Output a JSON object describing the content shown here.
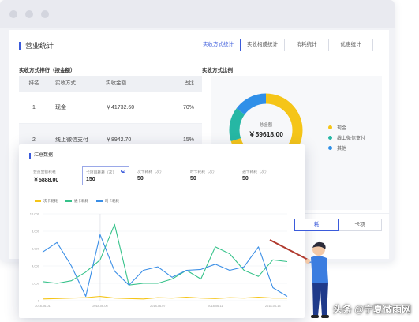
{
  "window": {
    "section_title": "营业统计"
  },
  "tabs": [
    "实收方式统计",
    "实收构成统计",
    "消耗统计",
    "优惠统计"
  ],
  "ranking": {
    "title": "实收方式排行（按金额）",
    "headers": [
      "排名",
      "实收方式",
      "实收金额",
      "占比"
    ],
    "rows": [
      {
        "rank": "1",
        "method": "现金",
        "amount": "￥41732.60",
        "percent": "70%"
      },
      {
        "rank": "2",
        "method": "线上微信支付",
        "amount": "￥8942.70",
        "percent": "15%"
      }
    ]
  },
  "ratio": {
    "title": "实收方式比例",
    "total_label": "总金额",
    "total_value": "￥59618.00",
    "legend": [
      {
        "name": "现金",
        "color": "#f5c518",
        "share": 0.7
      },
      {
        "name": "线上微信支付",
        "color": "#26b7a4",
        "share": 0.15
      },
      {
        "name": "其他",
        "color": "#2f8fe8",
        "share": 0.15
      }
    ]
  },
  "lower_tabs": [
    "耗",
    "卡项"
  ],
  "summary": {
    "title": "汇总数据",
    "metrics": [
      {
        "label": "会员金额耗耗",
        "value": "￥5888.00"
      },
      {
        "label": "卡项目耗耗（次）",
        "value": "150"
      },
      {
        "label": "次卡耗耗（次）",
        "value": "50"
      },
      {
        "label": "时卡耗耗（次）",
        "value": "50"
      },
      {
        "label": "通卡耗耗（次）",
        "value": "50"
      }
    ]
  },
  "chart_data": {
    "type": "line",
    "ylim": [
      0,
      10000
    ],
    "yticks": [
      "10,000",
      "8,000",
      "6,000",
      "4,000",
      "2,000",
      "0"
    ],
    "x_ticks": [
      "2018-06-01",
      "2018-06-06",
      "2018-06-07",
      "2018-06-11",
      "2018-06-13"
    ],
    "x_tick_positions": [
      0,
      4,
      8,
      12,
      16
    ],
    "series": [
      {
        "name": "次卡耗耗",
        "color": "#f5c518",
        "values": [
          200,
          250,
          300,
          350,
          500,
          300,
          250,
          200,
          350,
          300,
          400,
          300,
          250,
          350,
          300,
          400,
          300,
          300
        ]
      },
      {
        "name": "通卡耗耗",
        "color": "#36c28a",
        "values": [
          2200,
          2000,
          2300,
          3300,
          4700,
          8800,
          1800,
          2000,
          2000,
          2500,
          3500,
          2500,
          6200,
          5400,
          3500,
          2800,
          4700,
          4500
        ]
      },
      {
        "name": "时卡耗耗",
        "color": "#3a8ee6",
        "values": [
          5600,
          6700,
          4000,
          500,
          7600,
          3400,
          1800,
          3500,
          3900,
          2700,
          3500,
          3600,
          4200,
          3500,
          3900,
          6200,
          1500,
          500
        ]
      }
    ]
  },
  "watermark": "头条 @宁夏微雨网"
}
